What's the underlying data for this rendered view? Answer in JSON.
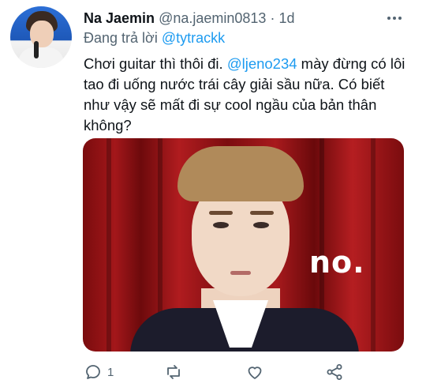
{
  "tweet": {
    "display_name": "Na Jaemin",
    "handle": "@na.jaemin0813",
    "separator": "·",
    "time": "1d",
    "reply_prefix": "Đang trả lời ",
    "reply_to": "@tytrackk",
    "text_part1": "Chơi guitar thì thôi đi. ",
    "mention": "@ljeno234",
    "text_part2": " mày đừng có lôi tao đi uống nước trái cây giải sầu nữa. Có biết như vậy sẽ mất đi sự cool ngầu của bản thân không?",
    "media_caption": "no.",
    "reply_count": "1"
  },
  "icons": {
    "more": "more-horizontal-icon",
    "reply": "comment-icon",
    "retweet": "retweet-icon",
    "like": "heart-icon",
    "share": "share-icon"
  },
  "colors": {
    "link": "#1d9bf0",
    "muted": "#536471",
    "text": "#0f1419"
  }
}
